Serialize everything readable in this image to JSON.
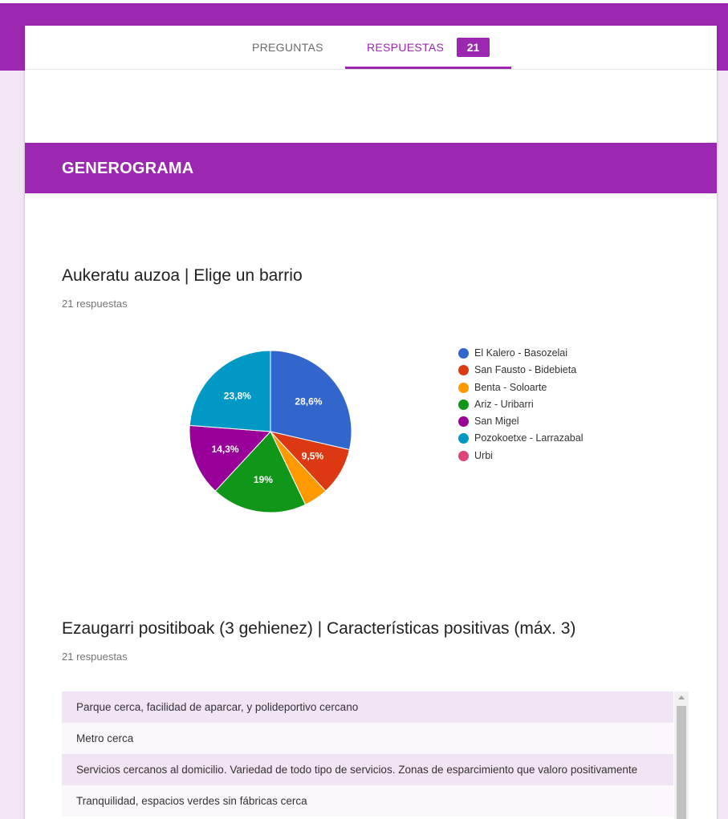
{
  "tabs": {
    "preguntas": "PREGUNTAS",
    "respuestas": "RESPUESTAS",
    "count": "21"
  },
  "section": {
    "title": "GENEROGRAMA"
  },
  "questions": [
    {
      "title": "Aukeratu auzoa | Elige un barrio",
      "count": "21 respuestas"
    },
    {
      "title": "Ezaugarri positiboak (3 gehienez) | Características positivas (máx. 3)",
      "count": "21 respuestas"
    }
  ],
  "chart_data": {
    "type": "pie",
    "title": "",
    "categories": [
      "El Kalero - Basozelai",
      "San Fausto - Bidebieta",
      "Benta - Soloarte",
      "Ariz - Uribarri",
      "San Migel",
      "Pozokoetxe - Larrazabal",
      "Urbi"
    ],
    "values": [
      28.6,
      9.5,
      4.8,
      19,
      14.3,
      23.8,
      0
    ],
    "labels": [
      "28,6%",
      "9,5%",
      "",
      "19%",
      "14,3%",
      "23,8%",
      ""
    ],
    "colors": [
      "#3366cc",
      "#dc3912",
      "#ff9900",
      "#109618",
      "#990099",
      "#0099c6",
      "#dd4477"
    ],
    "legend_position": "right"
  },
  "responses": [
    "Parque cerca, facilidad de aparcar, y polideportivo cercano",
    "Metro cerca",
    "Servicios cercanos al domicilio. Variedad de todo tipo de servicios. Zonas de esparcimiento que valoro positivamente",
    "Tranquilidad, espacios verdes sin fábricas cerca"
  ]
}
